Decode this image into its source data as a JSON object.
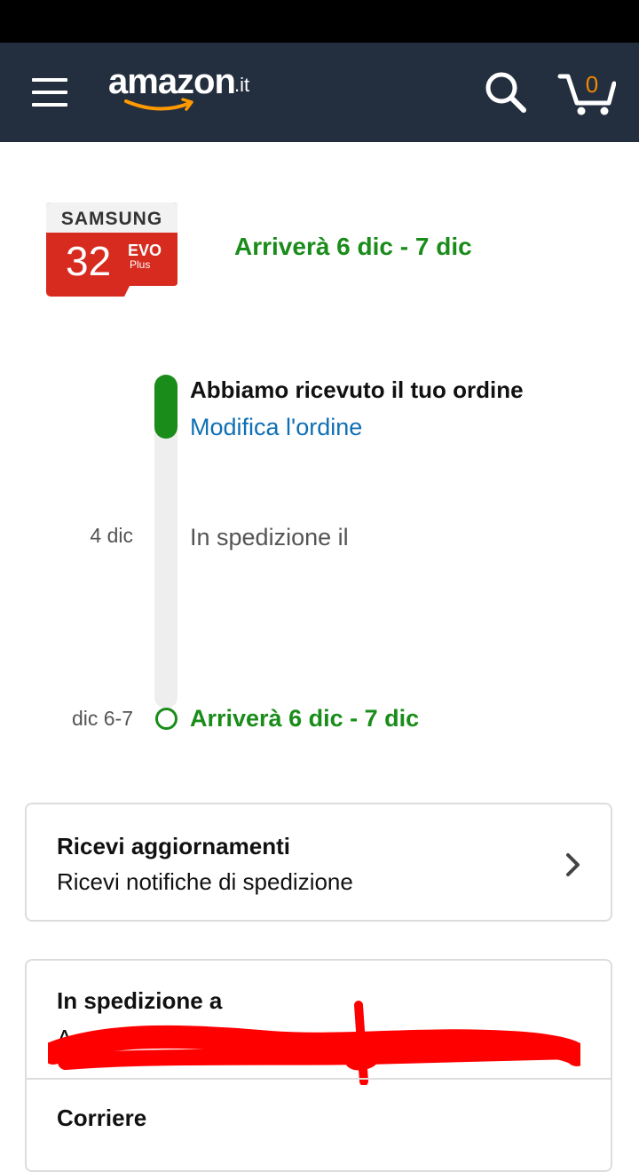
{
  "header": {
    "logo_text": "amazon",
    "logo_tld": ".it",
    "cart_count": "0",
    "colors": {
      "bar": "#232f3e",
      "cart_count": "#f08804",
      "smile": "#f90"
    }
  },
  "product": {
    "image_brand": "SAMSUNG",
    "image_capacity": "32",
    "image_line": "EVO",
    "image_sub": "Plus",
    "eta": "Arriverà 6 dic - 7 dic"
  },
  "tracking": {
    "step_received_title": "Abbiamo ricevuto il tuo ordine",
    "modify_link": "Modifica l'ordine",
    "step_shipping_date": "4 dic",
    "step_shipping_text": "In spedizione il",
    "step_arrival_date": "dic 6-7",
    "step_arrival_text": "Arriverà 6 dic - 7 dic",
    "colors": {
      "progress": "#1a8c1a",
      "rail": "#eeeeee",
      "link": "#0f6fb5"
    }
  },
  "updates_card": {
    "title": "Ricevi aggiornamenti",
    "subtitle": "Ricevi notifiche di spedizione"
  },
  "shipping_card": {
    "title": "In spedizione a",
    "address_visible_prefix": "A",
    "carrier_title": "Corriere"
  }
}
